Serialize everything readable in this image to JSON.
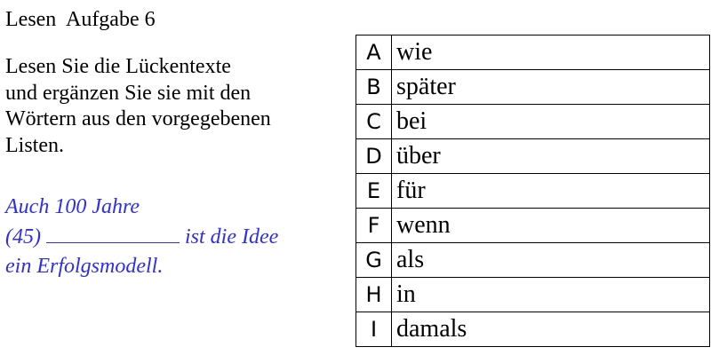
{
  "header": {
    "title": "Lesen  Aufgabe 6"
  },
  "instructions": {
    "lines": [
      "Lesen Sie die Lückentexte",
      "und ergänzen Sie sie mit den",
      "Wörtern aus den vorgegebenen",
      "Listen."
    ]
  },
  "exercise": {
    "line1": "Auch 100 Jahre",
    "gap_number": "(45)",
    "after_gap": "ist die Idee",
    "line3": "ein Erfolgsmodell.",
    "text_color": "#2d2df0"
  },
  "options": [
    {
      "letter": "A",
      "word": "wie"
    },
    {
      "letter": "B",
      "word": "später"
    },
    {
      "letter": "C",
      "word": "bei"
    },
    {
      "letter": "D",
      "word": "über"
    },
    {
      "letter": "E",
      "word": "für"
    },
    {
      "letter": "F",
      "word": "wenn"
    },
    {
      "letter": "G",
      "word": "als"
    },
    {
      "letter": "H",
      "word": "in"
    },
    {
      "letter": "I",
      "word": "damals"
    }
  ]
}
